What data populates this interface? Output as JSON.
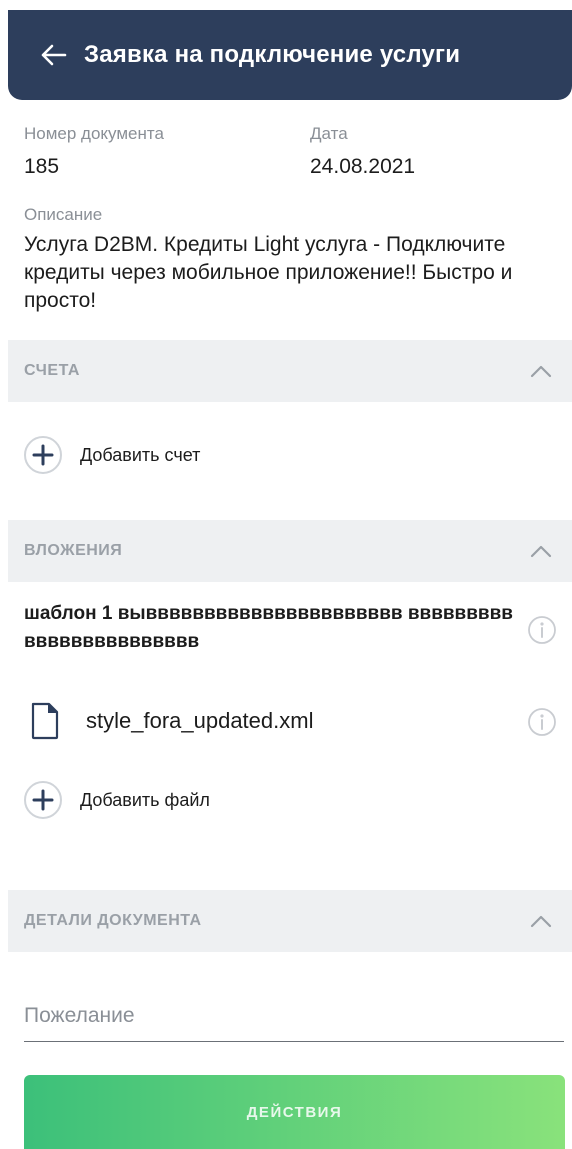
{
  "header": {
    "title": "Заявка на подключение услуги"
  },
  "document": {
    "number_label": "Номер документа",
    "number_value": "185",
    "date_label": "Дата",
    "date_value": "24.08.2021",
    "description_label": "Описание",
    "description_value": "Услуга D2BM. Кредиты Light услуга - Подключите кредиты через мобильное приложение!! Быстро и просто!"
  },
  "accounts": {
    "section_title": "СЧЕТА",
    "add_label": "Добавить счет"
  },
  "attachments": {
    "section_title": "ВЛОЖЕНИЯ",
    "template_title": "шаблон 1 вывввввввввввввввввввввв вввввввввввввввввввввввв",
    "file_name": "style_fora_updated.xml",
    "add_label": "Добавить файл"
  },
  "details": {
    "section_title": "ДЕТАЛИ ДОКУМЕНТА",
    "wish_placeholder": "Пожелание"
  },
  "actions": {
    "label": "ДЕЙСТВИЯ"
  },
  "colors": {
    "header_bg": "#2d3e5c",
    "section_bg": "#eef0f2",
    "button_start": "#3cc07a",
    "button_end": "#89e27b"
  }
}
